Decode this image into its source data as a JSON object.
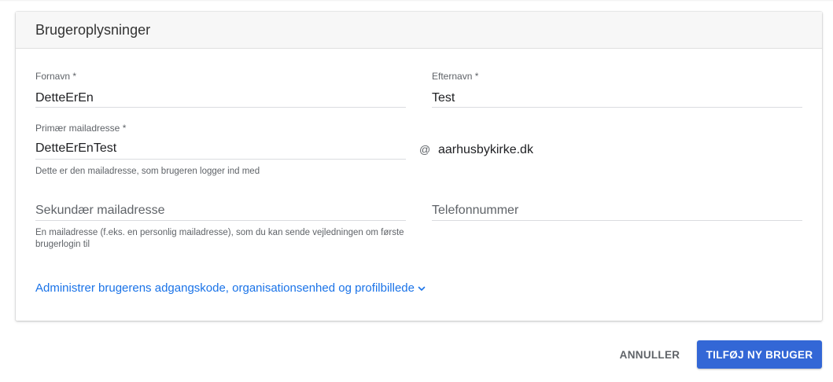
{
  "card": {
    "title": "Brugeroplysninger"
  },
  "form": {
    "first_name": {
      "label": "Fornavn *",
      "value": "DetteErEn"
    },
    "last_name": {
      "label": "Efternavn *",
      "value": "Test"
    },
    "primary_email": {
      "label": "Primær mailadresse *",
      "value": "DetteErEnTest",
      "at_symbol": "@",
      "domain": "aarhusbykirke.dk",
      "hint": "Dette er den mailadresse, som brugeren logger ind med"
    },
    "secondary_email": {
      "placeholder": "Sekundær mailadresse",
      "hint": "En mailadresse (f.eks. en personlig mailadresse), som du kan sende vejledningen om første brugerlogin til"
    },
    "phone": {
      "placeholder": "Telefonnummer"
    },
    "expand_link": {
      "label": "Administrer brugerens adgangskode, organisationsenhed og profilbillede",
      "icon": "chevron-down-icon"
    }
  },
  "actions": {
    "cancel_label": "ANNULLER",
    "submit_label": "TILFØJ NY BRUGER"
  },
  "colors": {
    "accent": "#3367d6",
    "link": "#1a73e8"
  }
}
